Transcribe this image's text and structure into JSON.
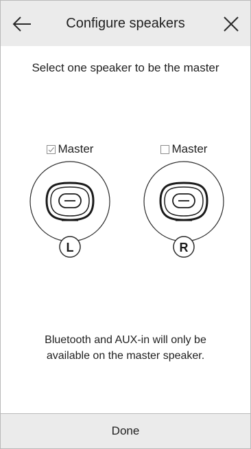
{
  "header": {
    "title": "Configure speakers",
    "back_icon": "back-arrow-icon",
    "close_icon": "close-icon"
  },
  "instruction": "Select one speaker to be the master",
  "speakers": [
    {
      "position": "L",
      "master_label": "Master",
      "is_master": true,
      "icon": "speaker-icon"
    },
    {
      "position": "R",
      "master_label": "Master",
      "is_master": false,
      "icon": "speaker-icon"
    }
  ],
  "note": "Bluetooth and AUX-in will only be available on the master speaker.",
  "done_label": "Done",
  "colors": {
    "header_bg": "#ebebeb",
    "footer_bg": "#ebebeb",
    "text": "#1f1f1f",
    "border": "#b9b9b9"
  }
}
